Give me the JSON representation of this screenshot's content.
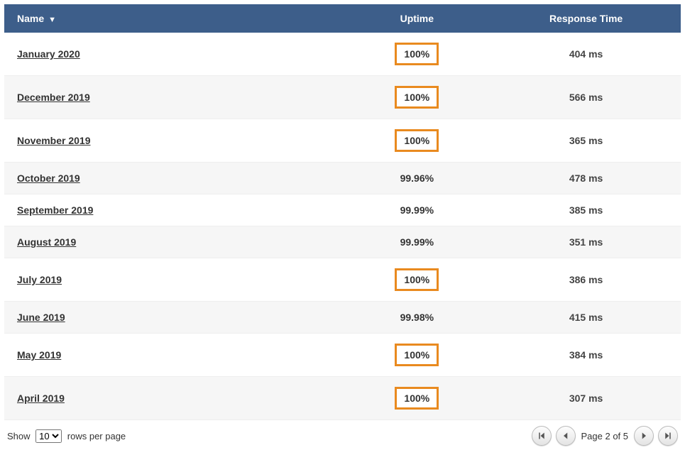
{
  "table": {
    "headers": {
      "name": "Name",
      "uptime": "Uptime",
      "response": "Response Time"
    },
    "sort_indicator": "▼",
    "rows": [
      {
        "name": "January 2020",
        "uptime": "100%",
        "uptime_highlight": true,
        "response": "404 ms"
      },
      {
        "name": "December 2019",
        "uptime": "100%",
        "uptime_highlight": true,
        "response": "566 ms"
      },
      {
        "name": "November 2019",
        "uptime": "100%",
        "uptime_highlight": true,
        "response": "365 ms"
      },
      {
        "name": "October 2019",
        "uptime": "99.96%",
        "uptime_highlight": false,
        "response": "478 ms"
      },
      {
        "name": "September 2019",
        "uptime": "99.99%",
        "uptime_highlight": false,
        "response": "385 ms"
      },
      {
        "name": "August 2019",
        "uptime": "99.99%",
        "uptime_highlight": false,
        "response": "351 ms"
      },
      {
        "name": "July 2019",
        "uptime": "100%",
        "uptime_highlight": true,
        "response": "386 ms"
      },
      {
        "name": "June 2019",
        "uptime": "99.98%",
        "uptime_highlight": false,
        "response": "415 ms"
      },
      {
        "name": "May 2019",
        "uptime": "100%",
        "uptime_highlight": true,
        "response": "384 ms"
      },
      {
        "name": "April 2019",
        "uptime": "100%",
        "uptime_highlight": true,
        "response": "307 ms"
      }
    ]
  },
  "footer": {
    "show_label_pre": "Show",
    "show_label_post": "rows per page",
    "rows_per_page_value": "10",
    "page_indicator": "Page 2 of 5"
  }
}
